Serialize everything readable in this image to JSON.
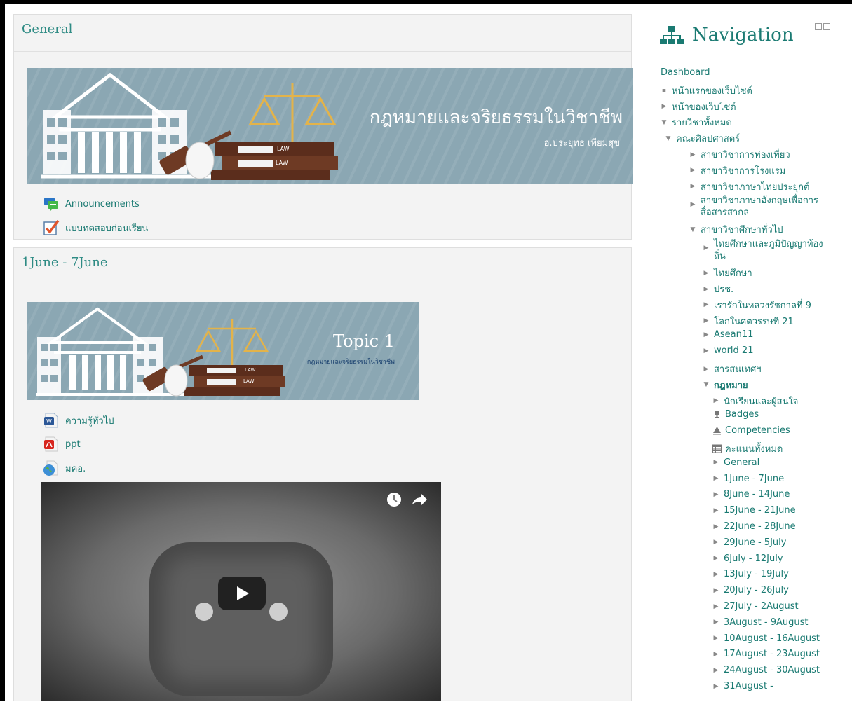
{
  "sections": [
    {
      "title": "General",
      "banner": {
        "title": "กฎหมายและจริยธรรมในวิชาชีพ",
        "subtitle": "อ.ประยุทธ เทียมสุข",
        "book_label": "LAW"
      },
      "activities": [
        {
          "label": "Announcements",
          "icon": "forum-icon"
        },
        {
          "label": "แบบทดสอบก่อนเรียน",
          "icon": "quiz-icon"
        }
      ]
    },
    {
      "title": "1June - 7June",
      "banner": {
        "title": "Topic 1",
        "subtitle": "กฎหมายและจริยธรรมในวิชาชีพ",
        "book_label": "LAW"
      },
      "activities": [
        {
          "label": "ความรู้ทั่วไป",
          "icon": "word-document-icon"
        },
        {
          "label": "ppt",
          "icon": "pdf-icon"
        },
        {
          "label": "มคอ.",
          "icon": "url-globe-icon"
        }
      ]
    }
  ],
  "video": {
    "watch_later_icon": "clock-icon",
    "share_icon": "share-arrow-icon",
    "play_icon": "play-icon"
  },
  "navigation": {
    "title": "Navigation",
    "items": [
      {
        "label": "Dashboard",
        "marker": "none",
        "indent": 0
      },
      {
        "label": "หน้าแรกของเว็บไซต์",
        "marker": "bullet",
        "indent": 0
      },
      {
        "label": "หน้าของเว็บไซต์",
        "marker": "collapsed",
        "indent": 0
      },
      {
        "label": "รายวิชาทั้งหมด",
        "marker": "expanded",
        "indent": 0
      },
      {
        "label": "คณะศิลปศาสตร์",
        "marker": "expanded",
        "indent": 1
      },
      {
        "label": "สาขาวิชาการท่องเที่ยว",
        "marker": "collapsed",
        "indent": 2
      },
      {
        "label": "สาขาวิชาการโรงแรม",
        "marker": "collapsed",
        "indent": 2
      },
      {
        "label": "สาขาวิชาภาษาไทยประยุกต์",
        "marker": "collapsed",
        "indent": 2
      },
      {
        "label": "สาขาวิชาภาษาอังกฤษเพื่อการ",
        "label2": "สื่อสารสากล",
        "marker": "collapsed",
        "indent": 2
      },
      {
        "label": "สาขาวิชาศึกษาทั่วไป",
        "marker": "expanded",
        "indent": 2
      },
      {
        "label": "ไทยศึกษาและภูมิปัญญาท้อง",
        "label2": "ถิ่น",
        "marker": "collapsed",
        "indent": 3
      },
      {
        "label": "ไทยศึกษา",
        "marker": "collapsed",
        "indent": 3
      },
      {
        "label": "ปรช.",
        "marker": "collapsed",
        "indent": 3
      },
      {
        "label": "เรารักในหลวงรัชกาลที่ 9",
        "marker": "collapsed",
        "indent": 3
      },
      {
        "label": "โลกในศตวรรษที่ 21",
        "marker": "collapsed",
        "indent": 3
      },
      {
        "label": "Asean11",
        "marker": "collapsed",
        "indent": 3
      },
      {
        "label": "world 21",
        "marker": "collapsed",
        "indent": 3
      },
      {
        "label": "สารสนเทศฯ",
        "marker": "collapsed",
        "indent": 3
      },
      {
        "label": "กฎหมาย",
        "marker": "expanded",
        "indent": 3,
        "bold": true
      },
      {
        "label": "นักเรียนและผู้สนใจ",
        "marker": "collapsed",
        "indent": 4
      },
      {
        "label": "Badges",
        "marker": "trophy",
        "indent": 4
      },
      {
        "label": "Competencies",
        "marker": "competency",
        "indent": 4
      },
      {
        "label": "คะแนนทั้งหมด",
        "marker": "grades",
        "indent": 4
      },
      {
        "label": "General",
        "marker": "collapsed",
        "indent": 4
      },
      {
        "label": "1June - 7June",
        "marker": "collapsed",
        "indent": 4
      },
      {
        "label": "8June - 14June",
        "marker": "collapsed",
        "indent": 4
      },
      {
        "label": "15June - 21June",
        "marker": "collapsed",
        "indent": 4
      },
      {
        "label": "22June - 28June",
        "marker": "collapsed",
        "indent": 4
      },
      {
        "label": "29June - 5July",
        "marker": "collapsed",
        "indent": 4
      },
      {
        "label": "6July - 12July",
        "marker": "collapsed",
        "indent": 4
      },
      {
        "label": "13July - 19July",
        "marker": "collapsed",
        "indent": 4
      },
      {
        "label": "20July - 26July",
        "marker": "collapsed",
        "indent": 4
      },
      {
        "label": "27July - 2August",
        "marker": "collapsed",
        "indent": 4
      },
      {
        "label": "3August - 9August",
        "marker": "collapsed",
        "indent": 4
      },
      {
        "label": "10August - 16August",
        "marker": "collapsed",
        "indent": 4
      },
      {
        "label": "17August - 23August",
        "marker": "collapsed",
        "indent": 4
      },
      {
        "label": "24August - 30August",
        "marker": "collapsed",
        "indent": 4
      },
      {
        "label": "31August -",
        "marker": "collapsed",
        "indent": 4
      }
    ]
  },
  "colors": {
    "link": "#1a7a72",
    "banner_bg": "#8ba7b3",
    "section_bg": "#f3f3f3"
  }
}
